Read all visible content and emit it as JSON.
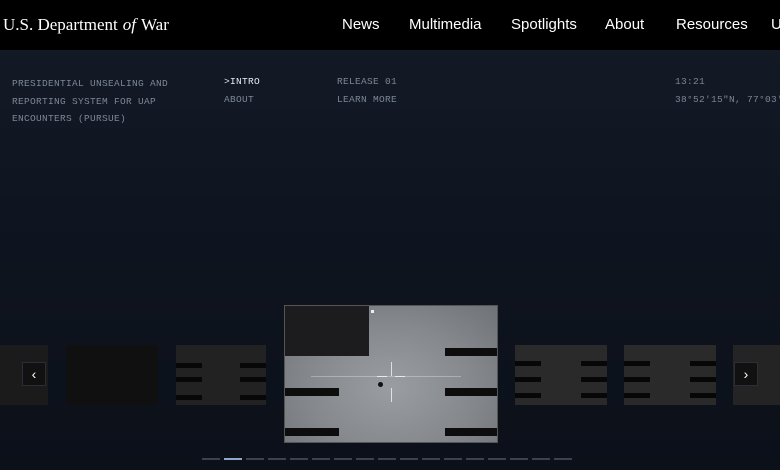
{
  "header": {
    "brand_pre": "U.S. Department",
    "brand_of": "of",
    "brand_post": "War",
    "nav": [
      "News",
      "Multimedia",
      "Spotlights",
      "About",
      "Resources",
      "U"
    ]
  },
  "info": {
    "tagline_lines": [
      "PRESIDENTIAL UNSEALING AND",
      "REPORTING SYSTEM FOR UAP",
      "ENCOUNTERS (PURSUE)"
    ],
    "links": [
      ">INTRO",
      "ABOUT"
    ],
    "release": [
      "RELEASE 01",
      "LEARN MORE"
    ],
    "time": "13:21",
    "coords": "38°52′15″N, 77°03′1"
  },
  "carousel": {
    "prev_glyph": "‹",
    "next_glyph": "›",
    "active_index": 3,
    "dots_count": 17,
    "active_dot": 1
  },
  "colors": {
    "header_bg": "#000000",
    "page_bg": "#0f1520",
    "dim_text": "#7d8796",
    "dot_active": "#8ea7c8"
  }
}
